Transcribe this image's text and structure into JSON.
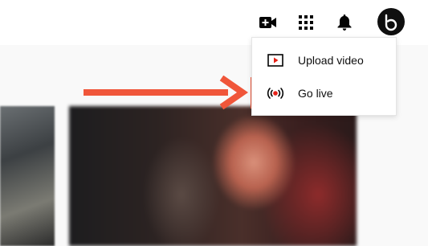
{
  "header": {
    "create_icon": "video-camera-plus-icon",
    "apps_icon": "apps-grid-icon",
    "notifications_icon": "bell-icon",
    "avatar_letter": "b"
  },
  "create_menu": {
    "items": [
      {
        "label": "Upload video",
        "icon": "upload-video-icon"
      },
      {
        "label": "Go live",
        "icon": "go-live-icon",
        "highlighted": true
      }
    ]
  },
  "annotation": {
    "arrow_color": "#f0563a",
    "box_color": "#f0563a"
  },
  "colors": {
    "live_red": "#ff0000",
    "text": "#0f0f0f",
    "icon": "#606060"
  }
}
